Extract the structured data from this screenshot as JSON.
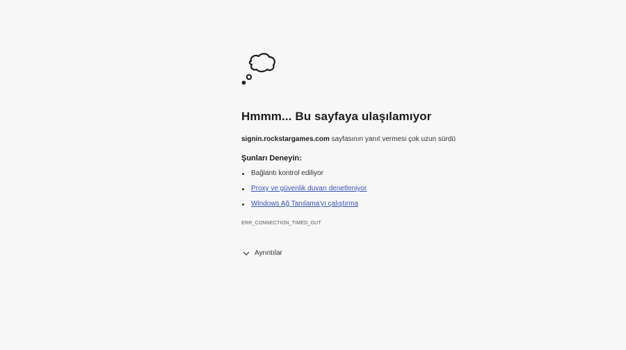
{
  "error": {
    "icon": "thought-cloud-icon",
    "heading": "Hmmm... Bu sayfaya ulaşılamıyor",
    "host": "signin.rockstargames.com",
    "description": "sayfasının yanıt vermesi çok uzun sürdü",
    "try_title": "Şunları Deneyin:",
    "tips": [
      "Bağlantı kontrol ediliyor",
      "Proxy ve güvenlik duvarı denetleniyor",
      "Windows Ağ Tanılama'yı çalıştırma"
    ],
    "code": "ERR_CONNECTION_TIMED_OUT",
    "details_label": "Ayrıntılar",
    "link_color": "#3a52b8"
  }
}
